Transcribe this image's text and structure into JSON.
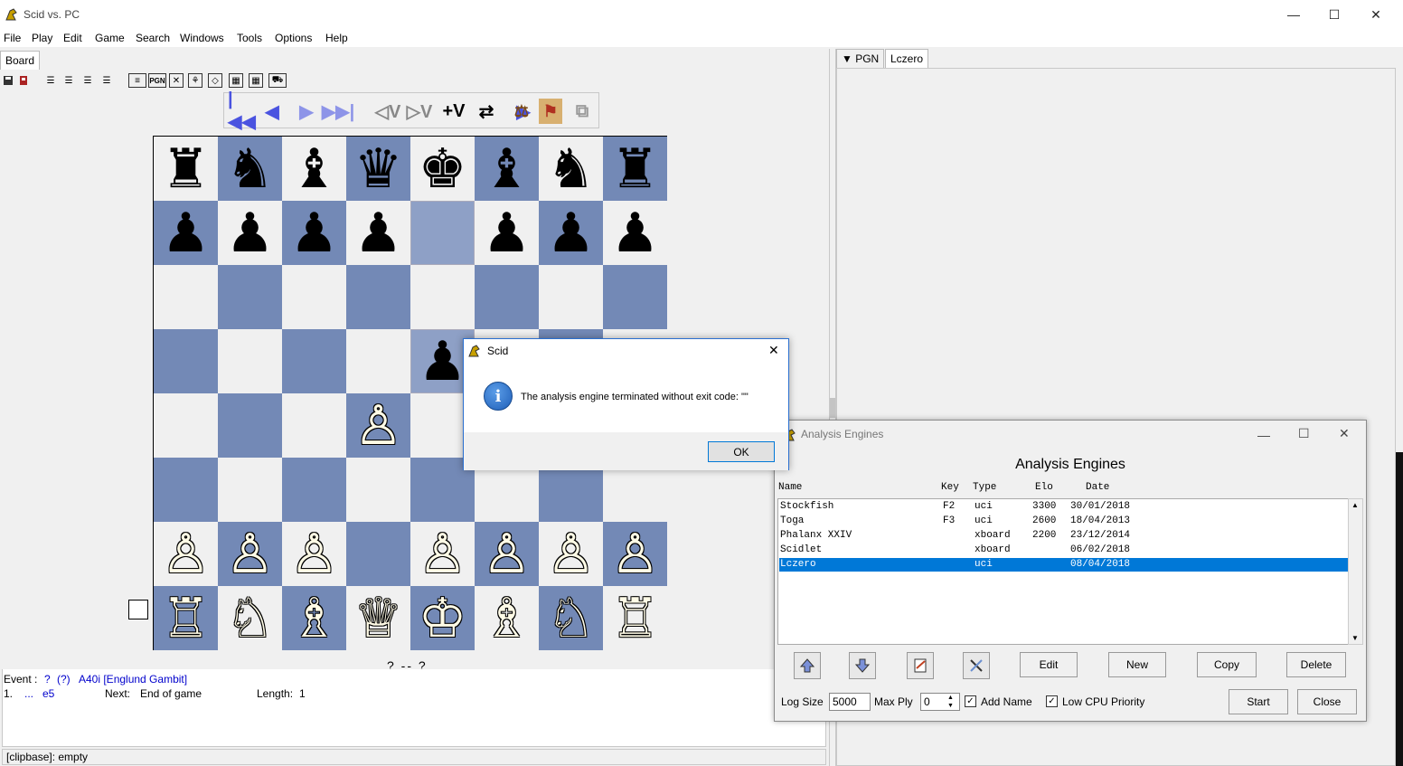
{
  "window": {
    "title": "Scid vs. PC",
    "minimize": "—",
    "maximize": "☐",
    "close": "✕"
  },
  "menu": [
    "File",
    "Play",
    "Edit",
    "Game",
    "Search",
    "Windows",
    "Tools",
    "Options",
    "Help"
  ],
  "left_tab": "Board",
  "right_tabs": {
    "pgn": "▼ PGN",
    "lczero": "Lczero"
  },
  "nav_buttons": [
    "|◀◀",
    "◀",
    "▶",
    "▶▶|",
    "◁V",
    "▷V",
    "+V",
    "⇄",
    "▶",
    "⚖",
    "⚑",
    "⧉"
  ],
  "board": {
    "ranks": [
      [
        "♜",
        "♞",
        "♝",
        "♛",
        "♚",
        "♝",
        "♞",
        "♜"
      ],
      [
        "♟",
        "♟",
        "♟",
        "♟",
        "",
        "♟",
        "♟",
        "♟"
      ],
      [
        "",
        "",
        "",
        "",
        "",
        "",
        "",
        ""
      ],
      [
        "",
        "",
        "",
        "",
        "♟",
        "",
        "",
        ""
      ],
      [
        "",
        "",
        "",
        "♙",
        "",
        "",
        "",
        ""
      ],
      [
        "",
        "",
        "",
        "",
        "",
        "",
        "",
        ""
      ],
      [
        "♙",
        "♙",
        "♙",
        "",
        "♙",
        "♙",
        "♙",
        "♙"
      ],
      [
        "♖",
        "♘",
        "♗",
        "♕",
        "♔",
        "♗",
        "♘",
        "♖"
      ]
    ]
  },
  "score_line": "?  --  ?",
  "game_info": {
    "event_label": "Event :",
    "event_value": "?",
    "event_extra": "(?)",
    "opening": "A40i [Englund Gambit]",
    "move_num": "1.",
    "move_dots": "...",
    "move": "e5",
    "next_label": "Next:",
    "next_value": "End of game",
    "length_label": "Length:",
    "length_value": "1"
  },
  "status": "[clipbase]:  empty",
  "dialog": {
    "title": "Scid",
    "message": "The analysis engine terminated without exit code: \"\"",
    "ok": "OK",
    "close": "✕"
  },
  "engines_window": {
    "title": "Analysis Engines",
    "heading": "Analysis Engines",
    "columns": {
      "name": "Name",
      "key": "Key",
      "type": "Type",
      "elo": "Elo",
      "date": "Date"
    },
    "rows": [
      {
        "name": "Stockfish",
        "key": "F2",
        "type": "uci",
        "elo": "3300",
        "date": "30/01/2018"
      },
      {
        "name": "Toga",
        "key": "F3",
        "type": "uci",
        "elo": "2600",
        "date": "18/04/2013"
      },
      {
        "name": "Phalanx XXIV",
        "key": "",
        "type": "xboard",
        "elo": "2200",
        "date": "23/12/2014"
      },
      {
        "name": "Scidlet",
        "key": "",
        "type": "xboard",
        "elo": "",
        "date": "06/02/2018"
      },
      {
        "name": "Lczero",
        "key": "",
        "type": "uci",
        "elo": "",
        "date": "08/04/2018"
      }
    ],
    "buttons": {
      "edit": "Edit",
      "new": "New",
      "copy": "Copy",
      "delete": "Delete",
      "start": "Start",
      "close": "Close"
    },
    "log_size_label": "Log Size",
    "log_size_value": "5000",
    "max_ply_label": "Max Ply",
    "max_ply_value": "0",
    "add_name_label": "Add Name",
    "low_cpu_label": "Low CPU Priority"
  }
}
